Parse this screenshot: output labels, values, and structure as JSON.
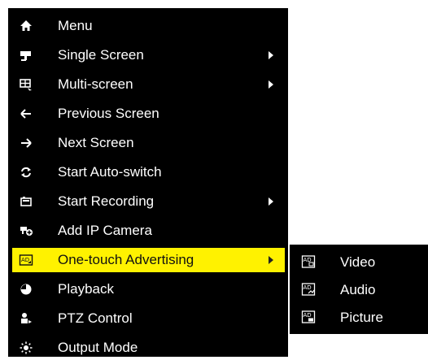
{
  "menu": {
    "items": [
      {
        "label": "Menu",
        "icon": "home-icon"
      },
      {
        "label": "Single Screen",
        "icon": "camera-icon",
        "submenu": true
      },
      {
        "label": "Multi-screen",
        "icon": "multi-screen-icon",
        "submenu": true
      },
      {
        "label": "Previous Screen",
        "icon": "arrow-left-icon"
      },
      {
        "label": "Next Screen",
        "icon": "arrow-right-icon"
      },
      {
        "label": "Start Auto-switch",
        "icon": "auto-switch-icon"
      },
      {
        "label": "Start Recording",
        "icon": "record-icon",
        "submenu": true
      },
      {
        "label": "Add IP Camera",
        "icon": "add-camera-icon"
      },
      {
        "label": "One-touch Advertising",
        "icon": "advertising-icon",
        "submenu": true,
        "highlighted": true
      },
      {
        "label": "Playback",
        "icon": "playback-icon"
      },
      {
        "label": "PTZ Control",
        "icon": "ptz-icon"
      },
      {
        "label": "Output Mode",
        "icon": "output-mode-icon"
      }
    ]
  },
  "submenu": {
    "items": [
      {
        "label": "Video",
        "icon": "ad-video-icon"
      },
      {
        "label": "Audio",
        "icon": "ad-audio-icon"
      },
      {
        "label": "Picture",
        "icon": "ad-picture-icon"
      }
    ]
  },
  "colors": {
    "menu_bg": "#000000",
    "text": "#ffffff",
    "highlight": "#fff200"
  }
}
